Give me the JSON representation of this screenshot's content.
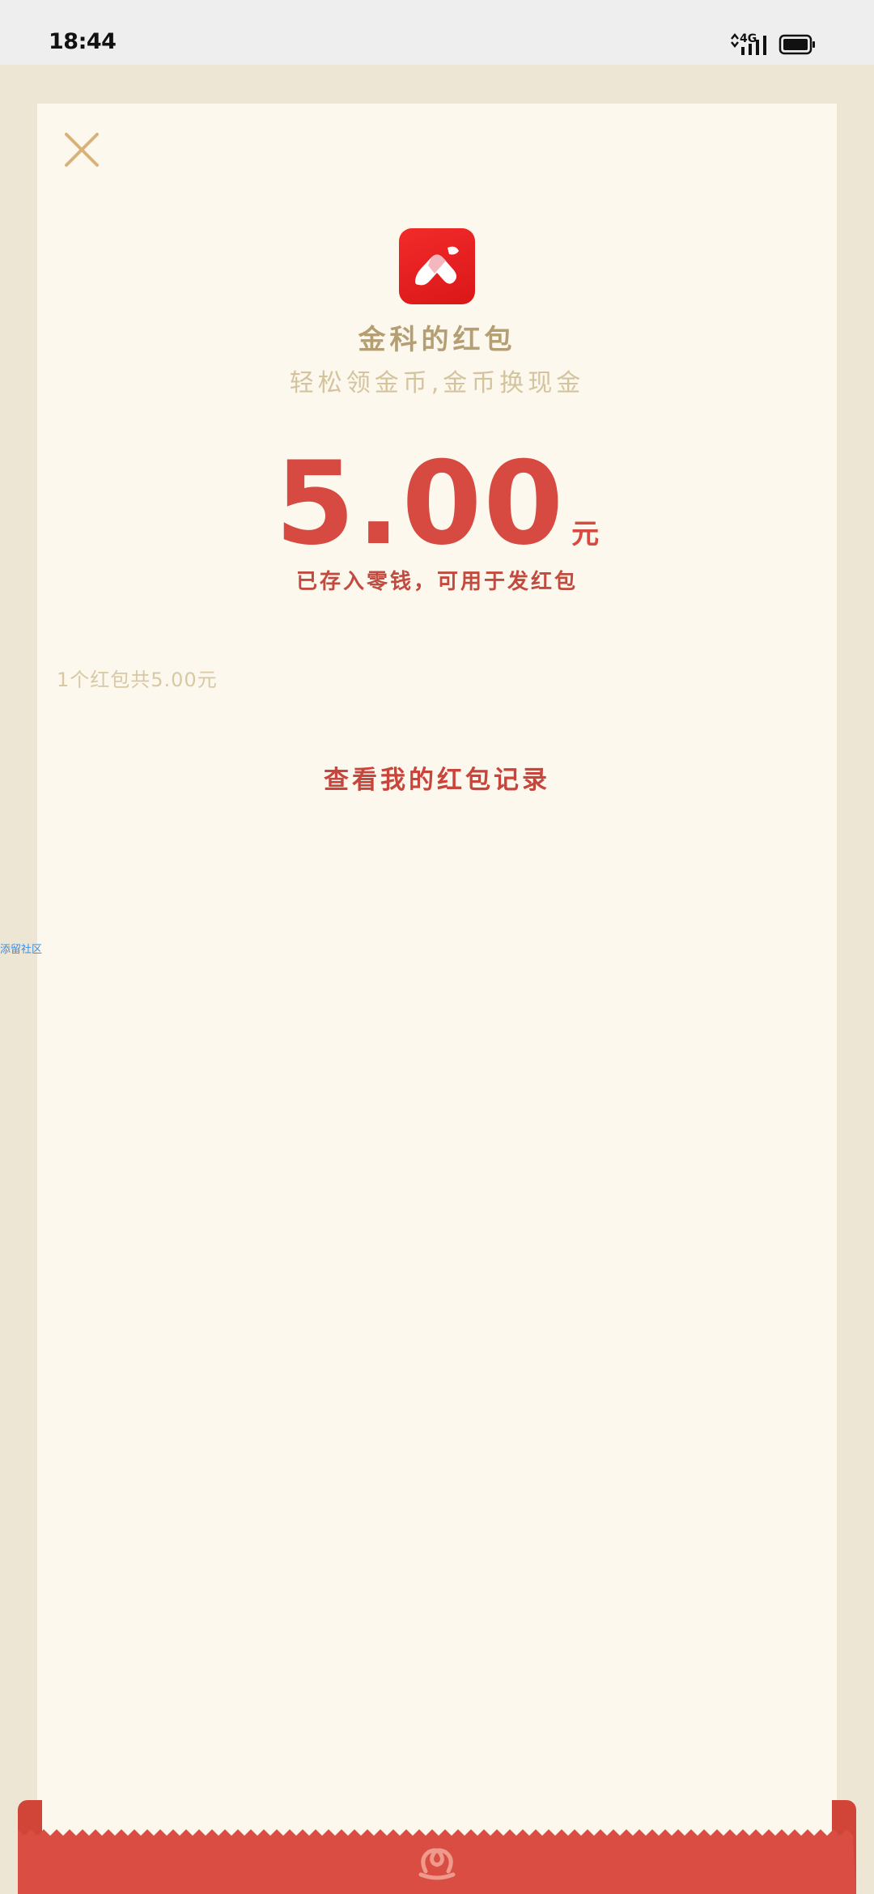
{
  "status_bar": {
    "time": "18:44",
    "network": "4G",
    "icons": [
      "signal-icon",
      "battery-icon"
    ]
  },
  "envelope": {
    "sender_name": "金科的红包",
    "slogan": "轻松领金币,金币换现金",
    "amount": "5.00",
    "unit": "元",
    "saved_note": "已存入零钱，可用于发红包",
    "summary": "1个红包共5.00元",
    "history_link": "查看我的红包记录"
  },
  "watermark": "添留社区",
  "colors": {
    "background": "#EEE6D4",
    "card": "#FCF8EE",
    "accent_red": "#D64A41",
    "gold_text": "#B49E72",
    "logo_red": "#E51F1F"
  }
}
